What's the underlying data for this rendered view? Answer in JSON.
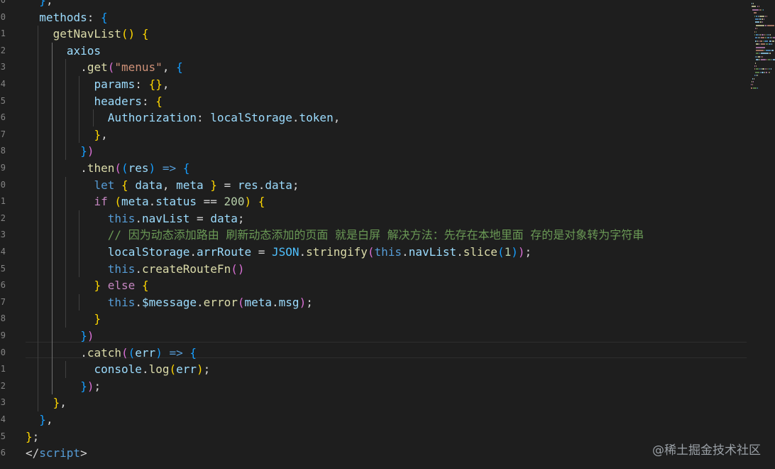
{
  "editor": {
    "line_numbers": [
      "0",
      "0",
      "1",
      "2",
      "3",
      "4",
      "5",
      "6",
      "7",
      "8",
      "9",
      "0",
      "1",
      "2",
      "3",
      "4",
      "5",
      "6",
      "7",
      "8",
      "9",
      "0",
      "1",
      "2",
      "3",
      "4",
      "5",
      "6"
    ],
    "colors": {
      "background": "#1e1e1e",
      "keyword": "#c586c0",
      "function": "#dcdcaa",
      "variable": "#9cdcfe",
      "string": "#ce9178",
      "comment": "#6a9955"
    },
    "lines": [
      [
        [
          "b3",
          "}"
        ],
        [
          "p",
          ","
        ]
      ],
      [
        [
          "v",
          "methods"
        ],
        [
          "p",
          ": "
        ],
        [
          "b3",
          "{"
        ]
      ],
      [
        [
          "f",
          "getNavList"
        ],
        [
          "b1",
          "()"
        ],
        [
          "p",
          " "
        ],
        [
          "b1",
          "{"
        ]
      ],
      [
        [
          "v",
          "axios"
        ]
      ],
      [
        [
          "p",
          "."
        ],
        [
          "f",
          "get"
        ],
        [
          "b2",
          "("
        ],
        [
          "s",
          "\"menus\""
        ],
        [
          "p",
          ", "
        ],
        [
          "b3",
          "{"
        ]
      ],
      [
        [
          "v",
          "params"
        ],
        [
          "p",
          ": "
        ],
        [
          "b1",
          "{}"
        ],
        [
          "p",
          ","
        ]
      ],
      [
        [
          "v",
          "headers"
        ],
        [
          "p",
          ": "
        ],
        [
          "b1",
          "{"
        ]
      ],
      [
        [
          "v",
          "Authorization"
        ],
        [
          "p",
          ": "
        ],
        [
          "v",
          "localStorage"
        ],
        [
          "p",
          "."
        ],
        [
          "v",
          "token"
        ],
        [
          "p",
          ","
        ]
      ],
      [
        [
          "b1",
          "}"
        ],
        [
          "p",
          ","
        ]
      ],
      [
        [
          "b3",
          "}"
        ],
        [
          "b2",
          ")"
        ]
      ],
      [
        [
          "p",
          "."
        ],
        [
          "f",
          "then"
        ],
        [
          "b2",
          "("
        ],
        [
          "b3",
          "("
        ],
        [
          "v",
          "res"
        ],
        [
          "b3",
          ")"
        ],
        [
          "p",
          " "
        ],
        [
          "kb",
          "=>"
        ],
        [
          "p",
          " "
        ],
        [
          "b3",
          "{"
        ]
      ],
      [
        [
          "kb",
          "let"
        ],
        [
          "p",
          " "
        ],
        [
          "b1",
          "{"
        ],
        [
          "p",
          " "
        ],
        [
          "v",
          "data"
        ],
        [
          "p",
          ", "
        ],
        [
          "v",
          "meta"
        ],
        [
          "p",
          " "
        ],
        [
          "b1",
          "}"
        ],
        [
          "p",
          " = "
        ],
        [
          "v",
          "res"
        ],
        [
          "p",
          "."
        ],
        [
          "v",
          "data"
        ],
        [
          "p",
          ";"
        ]
      ],
      [
        [
          "k",
          "if"
        ],
        [
          "p",
          " "
        ],
        [
          "b1",
          "("
        ],
        [
          "v",
          "meta"
        ],
        [
          "p",
          "."
        ],
        [
          "v",
          "status"
        ],
        [
          "p",
          " == "
        ],
        [
          "n",
          "200"
        ],
        [
          "b1",
          ")"
        ],
        [
          "p",
          " "
        ],
        [
          "b1",
          "{"
        ]
      ],
      [
        [
          "kb",
          "this"
        ],
        [
          "p",
          "."
        ],
        [
          "v",
          "navList"
        ],
        [
          "p",
          " = "
        ],
        [
          "v",
          "data"
        ],
        [
          "p",
          ";"
        ]
      ],
      [
        [
          "cm",
          "// 因为动态添加路由 刷新动态添加的页面 就是白屏 解决方法：先存在本地里面 存的是对象转为字符串"
        ]
      ],
      [
        [
          "v",
          "localStorage"
        ],
        [
          "p",
          "."
        ],
        [
          "v",
          "arrRoute"
        ],
        [
          "p",
          " = "
        ],
        [
          "c",
          "JSON"
        ],
        [
          "p",
          "."
        ],
        [
          "f",
          "stringify"
        ],
        [
          "b2",
          "("
        ],
        [
          "kb",
          "this"
        ],
        [
          "p",
          "."
        ],
        [
          "v",
          "navList"
        ],
        [
          "p",
          "."
        ],
        [
          "f",
          "slice"
        ],
        [
          "b3",
          "("
        ],
        [
          "n",
          "1"
        ],
        [
          "b3",
          ")"
        ],
        [
          "b2",
          ")"
        ],
        [
          "p",
          ";"
        ]
      ],
      [
        [
          "kb",
          "this"
        ],
        [
          "p",
          "."
        ],
        [
          "f",
          "createRouteFn"
        ],
        [
          "b2",
          "()"
        ]
      ],
      [
        [
          "b1",
          "}"
        ],
        [
          "p",
          " "
        ],
        [
          "k",
          "else"
        ],
        [
          "p",
          " "
        ],
        [
          "b1",
          "{"
        ]
      ],
      [
        [
          "kb",
          "this"
        ],
        [
          "p",
          "."
        ],
        [
          "v",
          "$message"
        ],
        [
          "p",
          "."
        ],
        [
          "f",
          "error"
        ],
        [
          "b2",
          "("
        ],
        [
          "v",
          "meta"
        ],
        [
          "p",
          "."
        ],
        [
          "v",
          "msg"
        ],
        [
          "b2",
          ")"
        ],
        [
          "p",
          ";"
        ]
      ],
      [
        [
          "b1",
          "}"
        ]
      ],
      [
        [
          "b3",
          "}"
        ],
        [
          "b2",
          ")"
        ]
      ],
      [
        [
          "p",
          "."
        ],
        [
          "f",
          "catch"
        ],
        [
          "b2",
          "("
        ],
        [
          "b3",
          "("
        ],
        [
          "v",
          "err"
        ],
        [
          "b3",
          ")"
        ],
        [
          "p",
          " "
        ],
        [
          "kb",
          "=>"
        ],
        [
          "p",
          " "
        ],
        [
          "b3",
          "{"
        ]
      ],
      [
        [
          "v",
          "console"
        ],
        [
          "p",
          "."
        ],
        [
          "f",
          "log"
        ],
        [
          "b1",
          "("
        ],
        [
          "v",
          "err"
        ],
        [
          "b1",
          ")"
        ],
        [
          "p",
          ";"
        ]
      ],
      [
        [
          "b3",
          "}"
        ],
        [
          "b2",
          ")"
        ],
        [
          "p",
          ";"
        ]
      ],
      [
        [
          "b1",
          "}"
        ],
        [
          "p",
          ","
        ]
      ],
      [
        [
          "b3",
          "}"
        ],
        [
          "p",
          ","
        ]
      ],
      [
        [
          "b1",
          "}"
        ],
        [
          "p",
          ";"
        ]
      ],
      [
        [
          "p",
          "</"
        ],
        [
          "kb",
          "script"
        ],
        [
          "p",
          ">"
        ]
      ]
    ]
  },
  "watermark": "@稀土掘金技术社区"
}
